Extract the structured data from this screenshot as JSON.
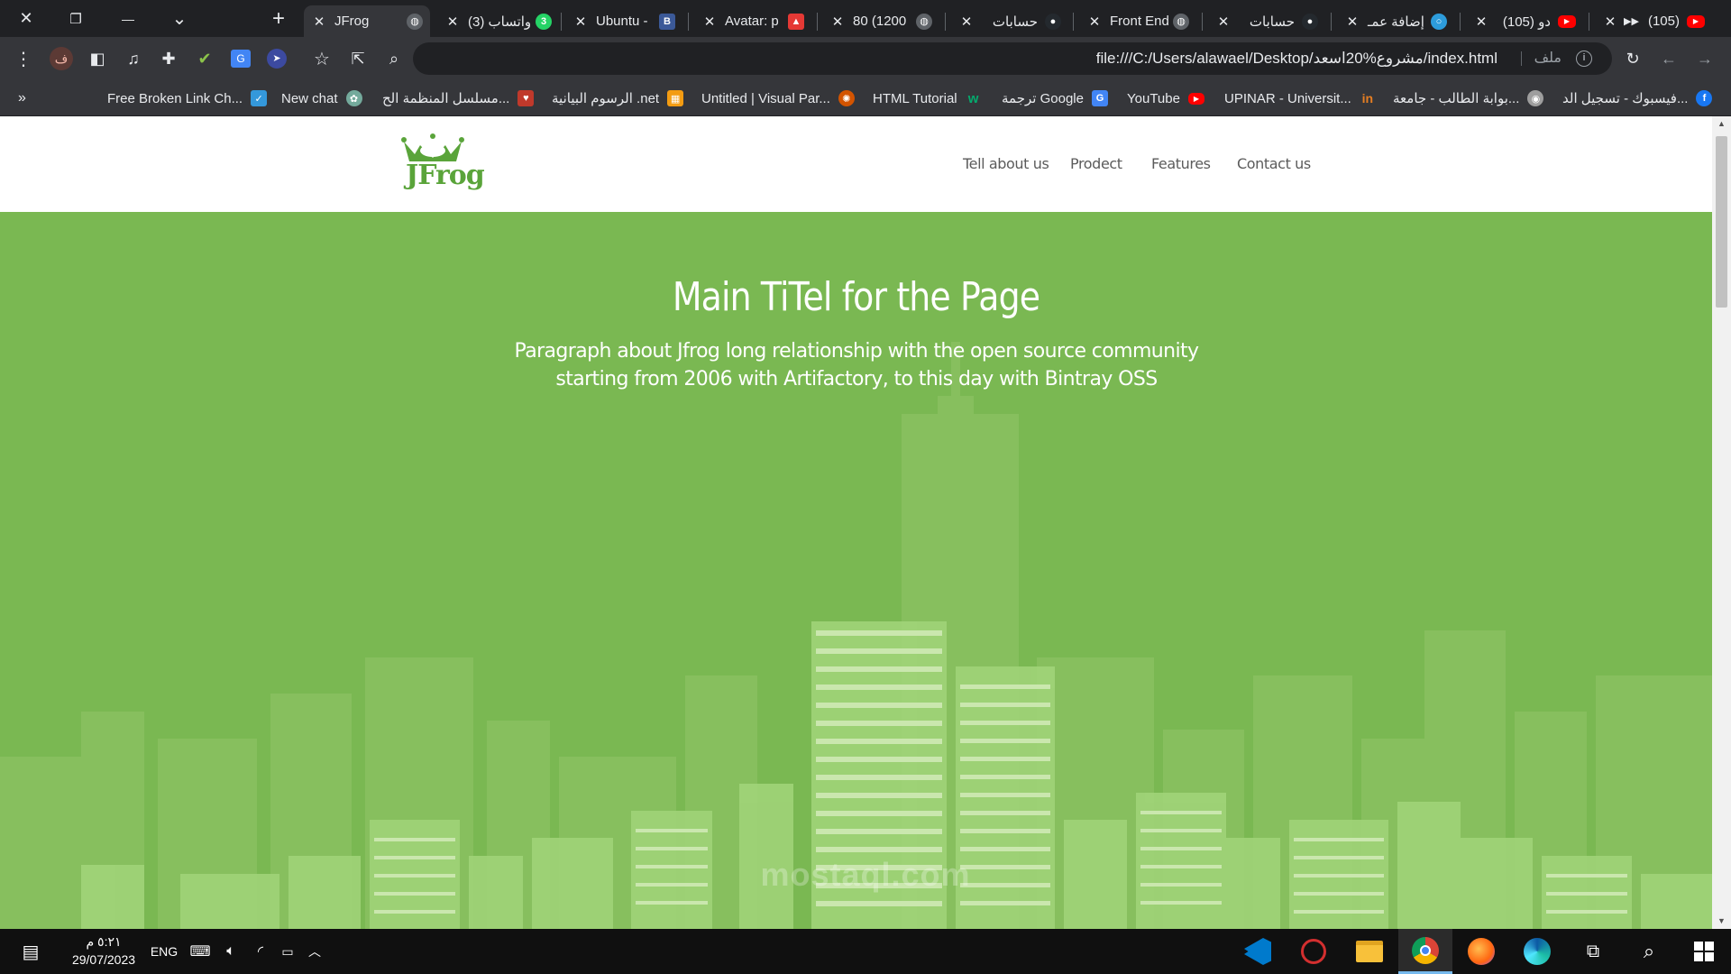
{
  "browser": {
    "window_controls": {
      "close": "✕",
      "restore": "❐",
      "minimize": "—",
      "tab_search": "⌄"
    },
    "new_tab": "+",
    "tabs": [
      {
        "title": "JFrog",
        "favicon": "globe-icon",
        "active": true
      },
      {
        "title": "(3) واتساب",
        "favicon": "whatsapp-icon",
        "badge": "3"
      },
      {
        "title": "Ubuntu -",
        "favicon": "ubuntu-icon"
      },
      {
        "title": "Avatar: p",
        "favicon": "fire-icon"
      },
      {
        "title": "80 (1200",
        "favicon": "globe-icon"
      },
      {
        "title": "حسابات",
        "favicon": "github-icon"
      },
      {
        "title": "Front End",
        "favicon": "globe-icon"
      },
      {
        "title": "حسابات",
        "favicon": "github-icon"
      },
      {
        "title": "إضافة عمـ",
        "favicon": "circle-icon"
      },
      {
        "title": "(105) دو",
        "favicon": "youtube-icon"
      },
      {
        "title": "(105)",
        "favicon": "youtube-icon"
      }
    ],
    "address": {
      "url": "file:///C:/Users/alawael/Desktop/مشروع%20اسعد/index.html",
      "scheme_label": "ملف"
    },
    "profile_initial": "ف",
    "bookmarks": [
      {
        "label": "فيسبوك - تسجيل الد...",
        "favicon": "facebook-icon",
        "color": "#1877f2"
      },
      {
        "label": "بوابة الطالب - جامعة...",
        "favicon": "university-icon",
        "color": "#9e9e9e"
      },
      {
        "label": "UPINAR - Universit...",
        "favicon": "upinar-icon",
        "color": "#e67e22"
      },
      {
        "label": "YouTube",
        "favicon": "youtube-icon",
        "color": "#ff0000"
      },
      {
        "label": "ترجمة Google",
        "favicon": "translate-icon",
        "color": "#4285f4"
      },
      {
        "label": "HTML Tutorial",
        "favicon": "w3schools-icon",
        "color": "#04aa6d"
      },
      {
        "label": "Untitled | Visual Par...",
        "favicon": "visual-paradigm-icon",
        "color": "#d35400"
      },
      {
        "label": "الرسوم البيانية .net",
        "favicon": "chart-icon",
        "color": "#f39c12"
      },
      {
        "label": "مسلسل المنظمة الح...",
        "favicon": "heart-icon",
        "color": "#c0392b"
      },
      {
        "label": "New chat",
        "favicon": "chatgpt-icon",
        "color": "#74aa9c"
      },
      {
        "label": "Free Broken Link Ch...",
        "favicon": "link-check-icon",
        "color": "#3498db"
      }
    ],
    "more_bookmarks": "»"
  },
  "page": {
    "logo_text": "JFrog",
    "nav": [
      {
        "label": "Tell about us"
      },
      {
        "label": "Prodect"
      },
      {
        "label": "Features"
      },
      {
        "label": "Contact us"
      }
    ],
    "hero": {
      "title": "Main TiTel for the Page",
      "paragraph": "Paragraph about Jfrog long relationship with the open source community starting from 2006 with Artifactory, to this day with Bintray OSS"
    },
    "brand_color": "#7ab852",
    "watermark": "mostaql.com"
  },
  "taskbar": {
    "time": "٥:٢١ م",
    "date": "29/07/2023",
    "language": "ENG",
    "apps": [
      "vscode-icon",
      "app-red-icon",
      "file-explorer-icon",
      "chrome-icon",
      "firefox-icon",
      "edge-icon",
      "task-view-icon",
      "search-icon",
      "start-icon"
    ]
  }
}
